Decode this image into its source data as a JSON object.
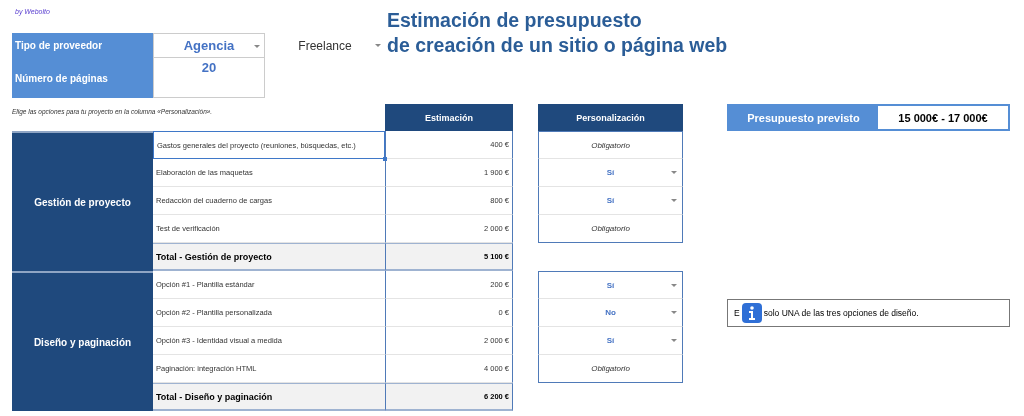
{
  "credit": "by Webolto",
  "title": [
    "Estimación de presupuesto",
    "de creación de un sitio o página web"
  ],
  "provider": {
    "label": "Tipo de proveedor",
    "options": [
      {
        "label": "Agencia",
        "selected": true
      },
      {
        "label": "Freelance",
        "selected": false
      }
    ]
  },
  "pages": {
    "label": "Número de páginas",
    "value": "20"
  },
  "hint": "Elige las opciones para tu proyecto en la columna «Personalización».",
  "columns": {
    "estimate": "Estimación",
    "personalization": "Personalización"
  },
  "budget": {
    "label": "Presupuesto previsto",
    "value": "15 000€ - 17 000€"
  },
  "sections": [
    {
      "name": "Gestión de proyecto",
      "items": [
        {
          "label": "Gastos generales del proyecto (reuniones, búsquedas, etc.)",
          "estimate": "400 €",
          "choice": {
            "kind": "fixed",
            "value": "Obligatorio"
          },
          "selected": true
        },
        {
          "label": "Elaboración de las maquetas",
          "estimate": "1 900 €",
          "choice": {
            "kind": "dropdown",
            "value": "Sí"
          },
          "selected": false
        },
        {
          "label": "Redacción del cuaderno de cargas",
          "estimate": "800 €",
          "choice": {
            "kind": "dropdown",
            "value": "Sí"
          },
          "selected": false
        },
        {
          "label": "Test de verificación",
          "estimate": "2 000 €",
          "choice": {
            "kind": "fixed",
            "value": "Obligatorio"
          },
          "selected": false
        }
      ],
      "total": {
        "label": "Total - Gestión de proyecto",
        "value": "5 100 €"
      }
    },
    {
      "name": "Diseño y paginación",
      "items": [
        {
          "label": "Opción #1 - Plantilla estándar",
          "estimate": "200 €",
          "choice": {
            "kind": "dropdown",
            "value": "Sí"
          },
          "selected": false
        },
        {
          "label": "Opción #2 - Plantilla personalizada",
          "estimate": "0 €",
          "choice": {
            "kind": "dropdown",
            "value": "No"
          },
          "selected": false,
          "note": {
            "before": "E",
            "after": "solo UNA de las tres opciones de diseño."
          }
        },
        {
          "label": "Opción #3 - Identidad visual a medida",
          "estimate": "2 000 €",
          "choice": {
            "kind": "dropdown",
            "value": "Sí"
          },
          "selected": false
        },
        {
          "label": "Paginación: integración HTML",
          "estimate": "4 000 €",
          "choice": {
            "kind": "fixed",
            "value": "Obligatorio"
          },
          "selected": false
        }
      ],
      "total": {
        "label": "Total - Diseño y paginación",
        "value": "6 200 €"
      }
    }
  ]
}
